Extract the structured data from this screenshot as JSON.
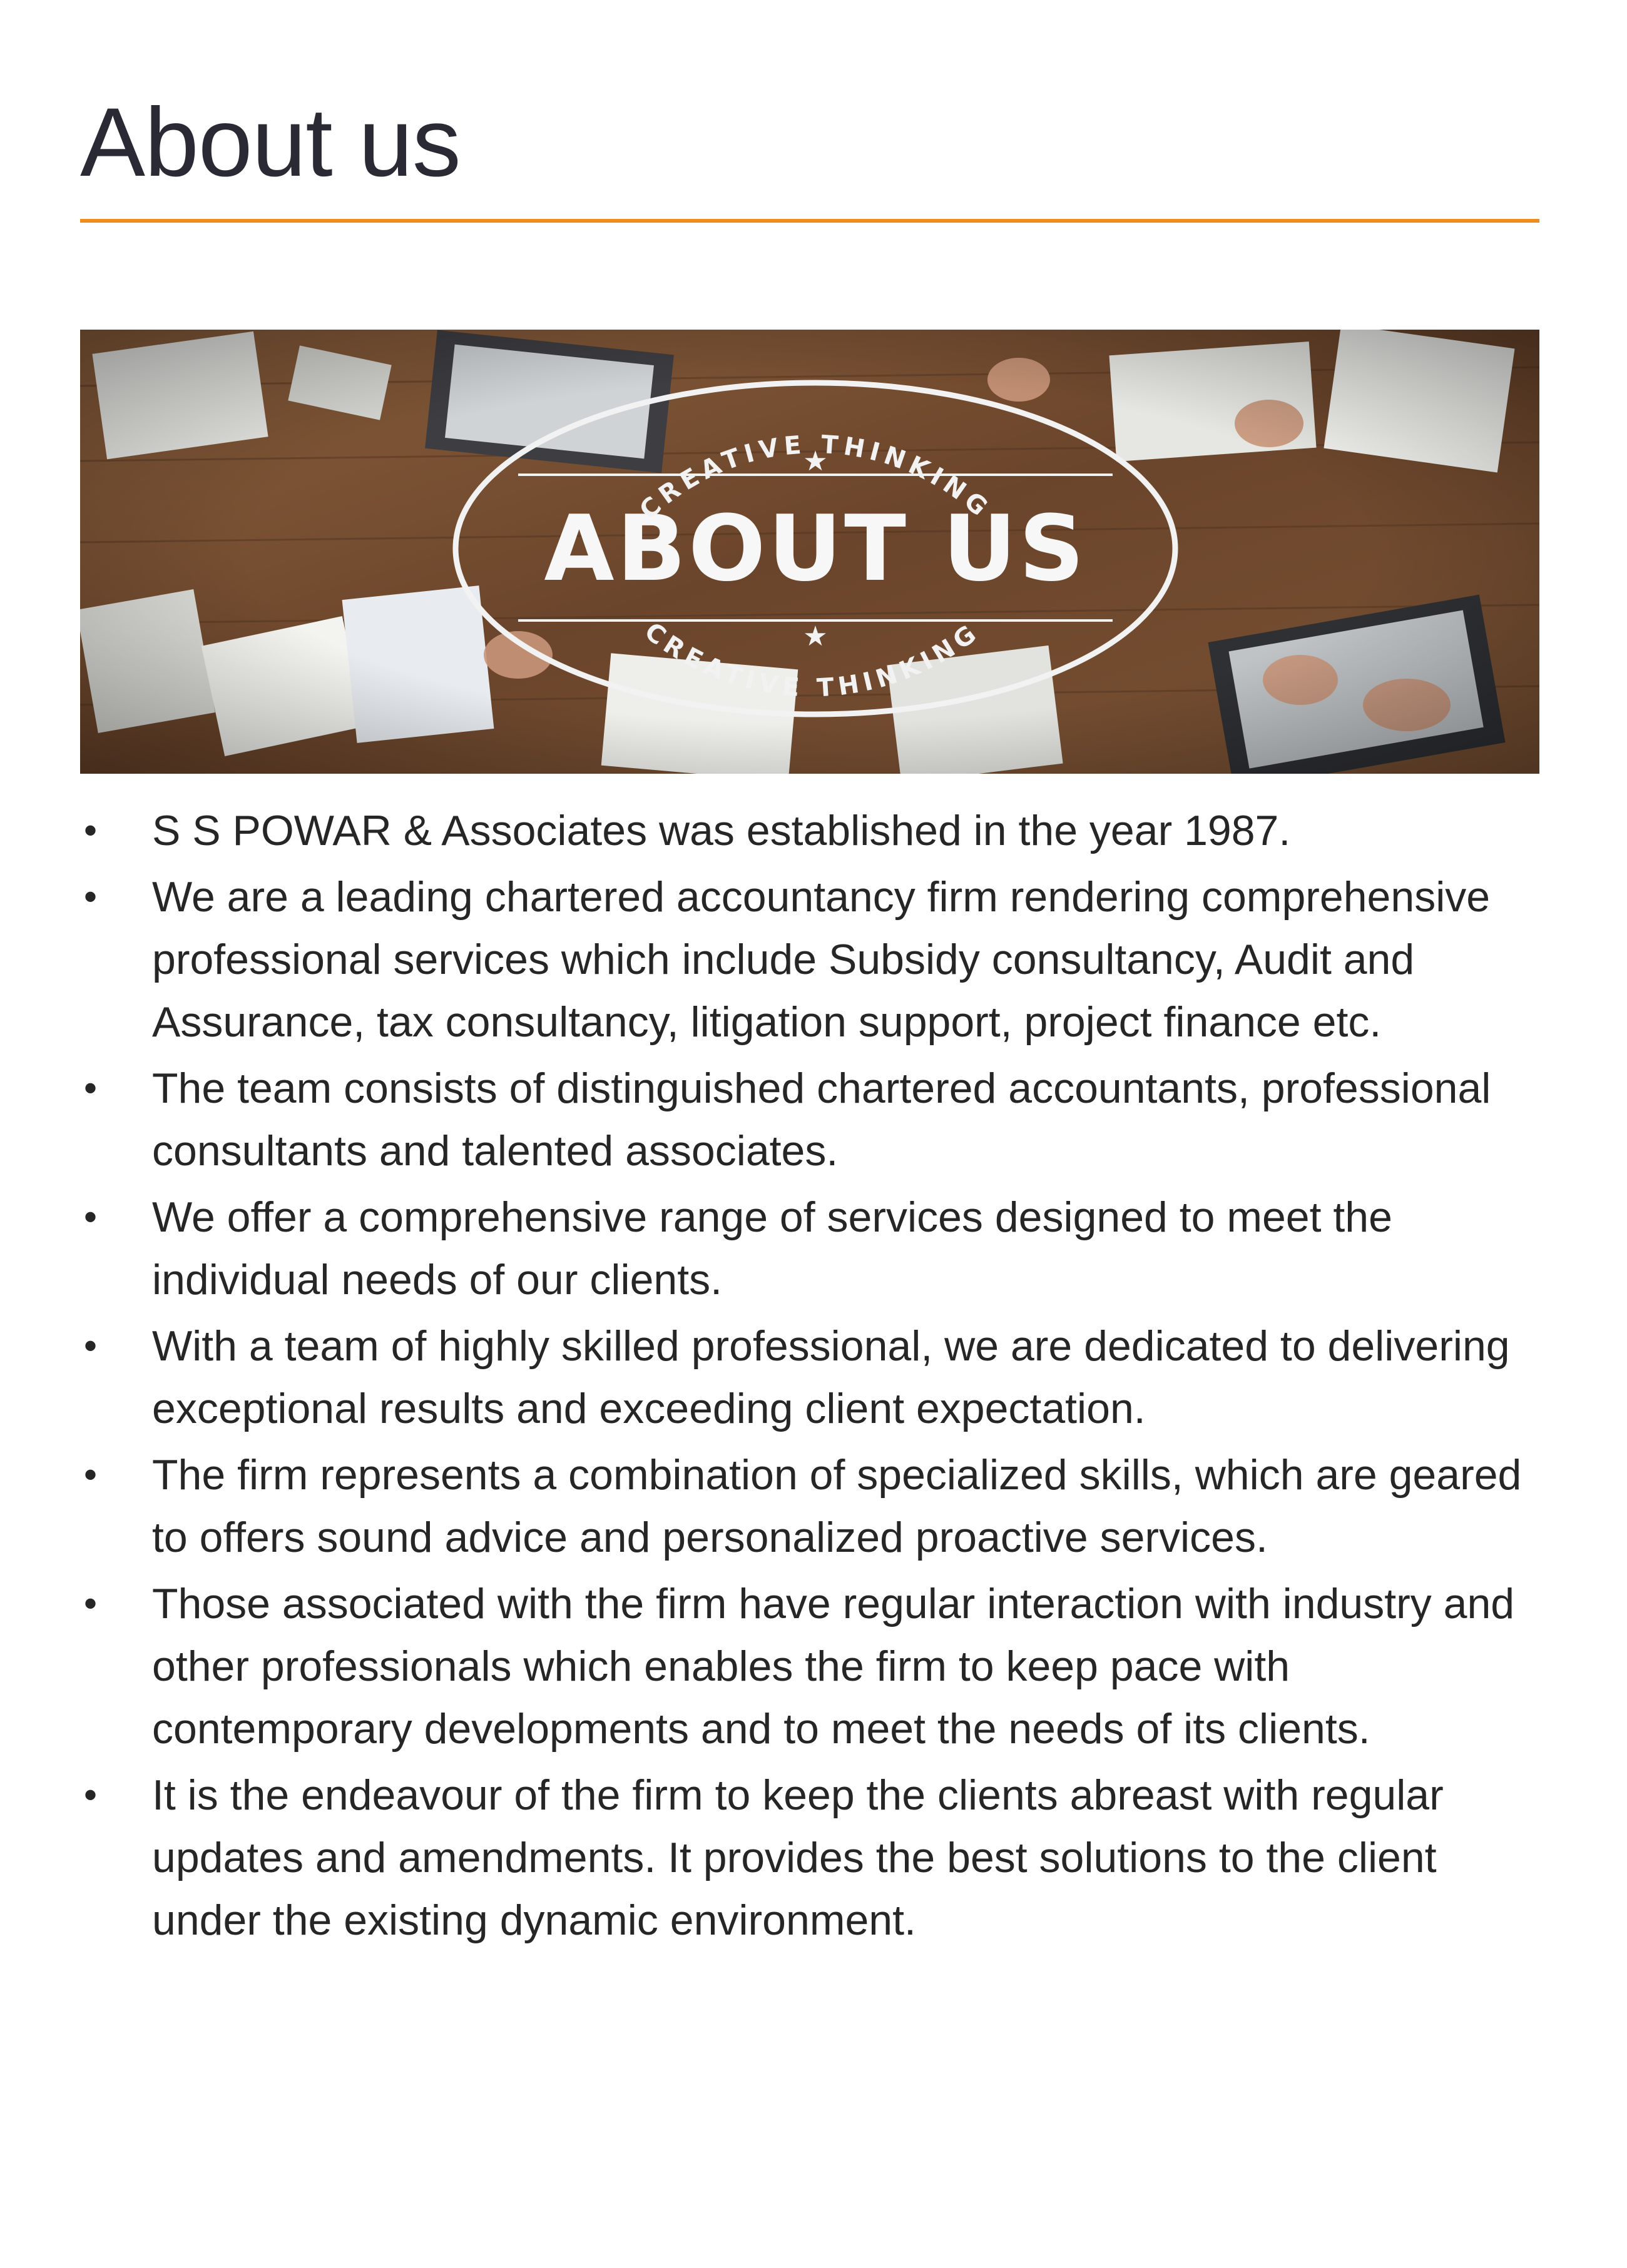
{
  "header": {
    "title": "About us",
    "accent_color": "#ee8c1c"
  },
  "banner": {
    "image_title": "ABOUT US",
    "arc_text_top": "CREATIVE THINKING",
    "arc_text_bottom": "CREATIVE THINKING"
  },
  "bullets": {
    "marker": "•",
    "items": [
      "S S POWAR & Associates was established in the year 1987.",
      "We are a leading chartered accountancy firm rendering comprehensive professional services which include Subsidy consultancy, Audit and Assurance, tax consultancy, litigation support, project finance etc.",
      "The team consists of distinguished chartered accountants, professional consultants and talented associates.",
      "We offer a comprehensive range of services designed to meet the individual needs of our clients.",
      "With a team of highly skilled professional, we are dedicated to delivering exceptional results and exceeding client expectation.",
      "The firm represents a combination of specialized skills, which are geared to offers sound advice and personalized proactive services.",
      "Those associated with the firm have regular interaction with industry and other professionals which enables the firm to keep pace with contemporary developments and to meet the needs of its clients.",
      "It is the endeavour of the firm to keep the clients abreast with regular updates and amendments. It provides the best solutions to the client under the existing dynamic environment."
    ]
  }
}
